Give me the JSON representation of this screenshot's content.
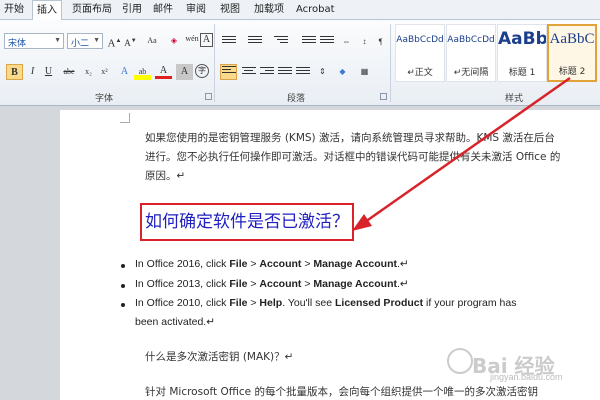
{
  "ribbon_tabs": [
    "开始",
    "插入",
    "页面布局",
    "引用",
    "邮件",
    "审阅",
    "视图",
    "加载项",
    "Acrobat"
  ],
  "font": {
    "family": "宋体",
    "size": "小二",
    "grow": "A",
    "shrink": "A",
    "clear_format": "Aa",
    "pinyin": "wén",
    "border_char": "A"
  },
  "format_buttons": {
    "bold": "B",
    "italic": "I",
    "underline": "U",
    "strike": "abe",
    "subscript": "x₂",
    "superscript": "x²",
    "text_effect": "A",
    "highlight": "ab",
    "font_color": "A",
    "char_shading": "A",
    "enclose": "字"
  },
  "group_labels": {
    "font": "字体",
    "paragraph": "段落",
    "styles": "样式"
  },
  "styles": [
    {
      "sample": "AaBbCcDd",
      "name": "↵正文"
    },
    {
      "sample": "AaBbCcDd",
      "name": "↵无间隔"
    },
    {
      "sample": "AaBb",
      "name": "标题 1"
    },
    {
      "sample": "AaBbC",
      "name": "标题 2"
    }
  ],
  "document": {
    "para1_line1": "如果您使用的是密钥管理服务 (KMS) 激活，请向系统管理员寻求帮助。KMS 激活在后台",
    "para1_line2": "进行。您不必执行任何操作即可激活。对话框中的错误代码可能提供有关未激活 Office 的",
    "para1_line3": "原因。↵",
    "heading": "如何确定软件是否已激活？",
    "bullets": [
      {
        "pre": "In Office 2016, click ",
        "b1": "File",
        "m1": " > ",
        "b2": "Account",
        "m2": " > ",
        "b3": "Manage Account",
        "post": ".↵"
      },
      {
        "pre": "In Office 2013, click ",
        "b1": "File",
        "m1": " > ",
        "b2": "Account",
        "m2": " > ",
        "b3": "Manage Account",
        "post": ".↵"
      },
      {
        "pre": "In Office 2010, click ",
        "b1": "File",
        "m1": " > ",
        "b2": "Help",
        "m2": ". You'll see ",
        "b3": "Licensed Product",
        "post": " if your program has"
      }
    ],
    "bullet3_cont": "been activated.↵",
    "mak_question": "什么是多次激活密钥 (MAK)？↵",
    "mak_text": "针对 Microsoft Office 的每个批量版本，会向每个组织提供一个唯一的多次激活密钥"
  },
  "watermark": {
    "brand": "Bai  经验",
    "url": "jingyan.baidu.com"
  },
  "colors": {
    "heading": "#2020c0",
    "highlight_box": "#d9232a",
    "selected_style": "#e2a23a"
  }
}
